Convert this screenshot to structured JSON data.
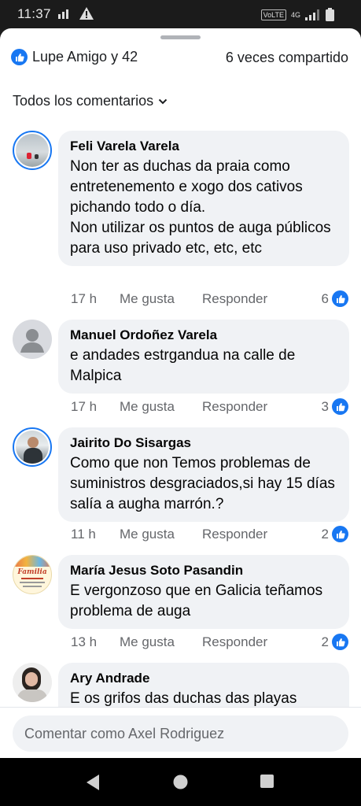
{
  "status": {
    "time": "11:37",
    "volte": "VoLTE",
    "network": "4G"
  },
  "header": {
    "reactions_text": "Lupe Amigo y 42",
    "shares_text": "6 veces compartido",
    "filter_label": "Todos los comentarios"
  },
  "comments": [
    {
      "author": "Feli Varela Varela",
      "text": "Non ter as duchas da praia como entretenemento e xogo dos cativos pichando todo o día.\nNon utilizar os puntos de auga públicos para uso privado etc, etc, etc",
      "time": "17 h",
      "like_label": "Me gusta",
      "reply_label": "Responder",
      "likes": "6"
    },
    {
      "author": "Manuel Ordoñez Varela",
      "text": "e andades estrgandua na calle de Malpica",
      "time": "17 h",
      "like_label": "Me gusta",
      "reply_label": "Responder",
      "likes": "3"
    },
    {
      "author": "Jairito Do Sisargas",
      "text": "Como que non Temos problemas de suministros desgraciados,si hay 15 días salía a augha marrón.?",
      "time": "11 h",
      "like_label": "Me gusta",
      "reply_label": "Responder",
      "likes": "2"
    },
    {
      "author": "María Jesus Soto Pasandin",
      "text": "E vergonzoso que en Galicia teñamos problema de auga",
      "time": "13 h",
      "like_label": "Me gusta",
      "reply_label": "Responder",
      "likes": "2",
      "avatar_text": "Familia"
    },
    {
      "author": "Ary Andrade",
      "text": "E os grifos das duchas das playas"
    }
  ],
  "composer": {
    "placeholder": "Comentar como Axel Rodriguez"
  },
  "colors": {
    "accent": "#1877f2",
    "bubble": "#f0f2f5",
    "meta": "#65676b"
  }
}
